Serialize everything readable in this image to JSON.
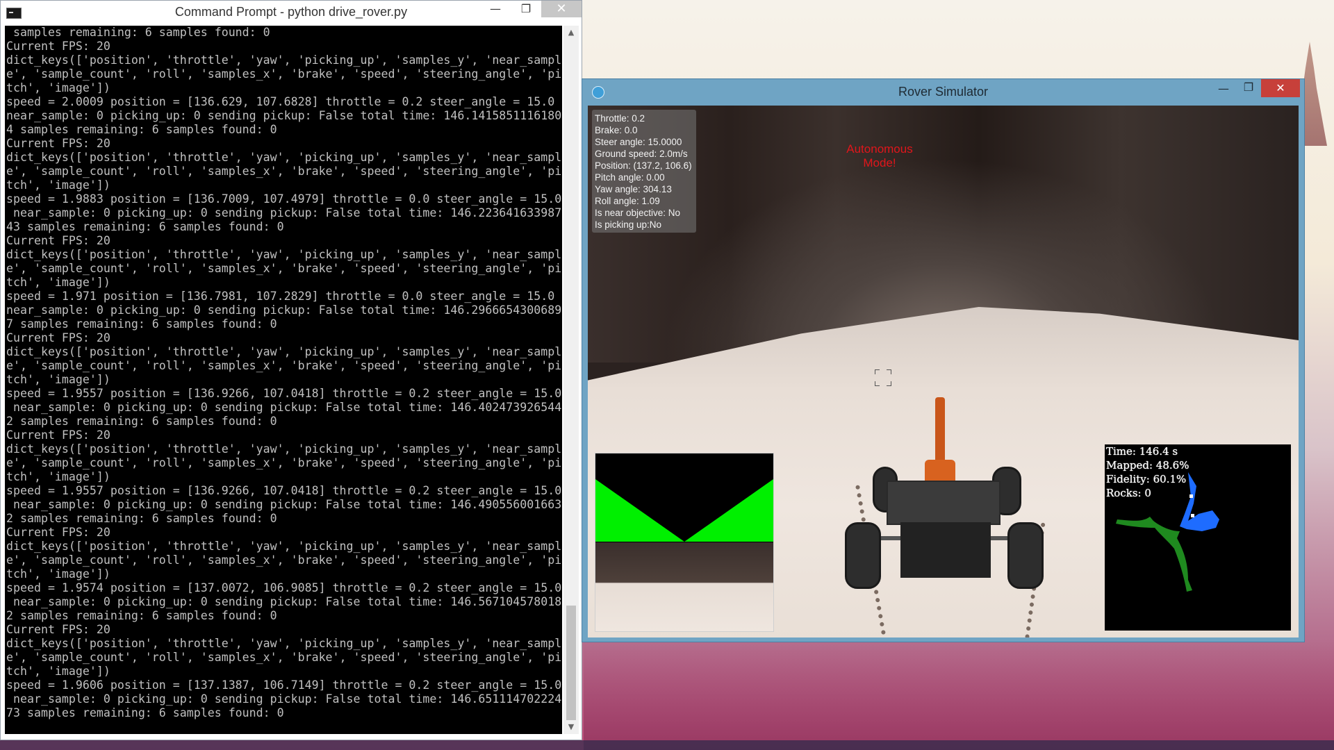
{
  "cmd": {
    "title": "Command Prompt - python  drive_rover.py",
    "minimize": "—",
    "maximize": "❐",
    "close": "✕",
    "lines": [
      " samples remaining: 6 samples found: 0",
      "Current FPS: 20",
      "dict_keys(['position', 'throttle', 'yaw', 'picking_up', 'samples_y', 'near_sampl",
      "e', 'sample_count', 'roll', 'samples_x', 'brake', 'speed', 'steering_angle', 'pi",
      "tch', 'image'])",
      "speed = 2.0009 position = [136.629, 107.6828] throttle = 0.2 steer_angle = 15.0",
      "near_sample: 0 picking_up: 0 sending pickup: False total time: 146.1415851116180",
      "4 samples remaining: 6 samples found: 0",
      "Current FPS: 20",
      "dict_keys(['position', 'throttle', 'yaw', 'picking_up', 'samples_y', 'near_sampl",
      "e', 'sample_count', 'roll', 'samples_x', 'brake', 'speed', 'steering_angle', 'pi",
      "tch', 'image'])",
      "speed = 1.9883 position = [136.7009, 107.4979] throttle = 0.0 steer_angle = 15.0",
      " near_sample: 0 picking_up: 0 sending pickup: False total time: 146.223641633987",
      "43 samples remaining: 6 samples found: 0",
      "Current FPS: 20",
      "dict_keys(['position', 'throttle', 'yaw', 'picking_up', 'samples_y', 'near_sampl",
      "e', 'sample_count', 'roll', 'samples_x', 'brake', 'speed', 'steering_angle', 'pi",
      "tch', 'image'])",
      "speed = 1.971 position = [136.7981, 107.2829] throttle = 0.0 steer_angle = 15.0",
      "near_sample: 0 picking_up: 0 sending pickup: False total time: 146.2966654300689",
      "7 samples remaining: 6 samples found: 0",
      "Current FPS: 20",
      "dict_keys(['position', 'throttle', 'yaw', 'picking_up', 'samples_y', 'near_sampl",
      "e', 'sample_count', 'roll', 'samples_x', 'brake', 'speed', 'steering_angle', 'pi",
      "tch', 'image'])",
      "speed = 1.9557 position = [136.9266, 107.0418] throttle = 0.2 steer_angle = 15.0",
      " near_sample: 0 picking_up: 0 sending pickup: False total time: 146.402473926544",
      "2 samples remaining: 6 samples found: 0",
      "Current FPS: 20",
      "dict_keys(['position', 'throttle', 'yaw', 'picking_up', 'samples_y', 'near_sampl",
      "e', 'sample_count', 'roll', 'samples_x', 'brake', 'speed', 'steering_angle', 'pi",
      "tch', 'image'])",
      "speed = 1.9557 position = [136.9266, 107.0418] throttle = 0.2 steer_angle = 15.0",
      " near_sample: 0 picking_up: 0 sending pickup: False total time: 146.490556001663",
      "2 samples remaining: 6 samples found: 0",
      "Current FPS: 20",
      "dict_keys(['position', 'throttle', 'yaw', 'picking_up', 'samples_y', 'near_sampl",
      "e', 'sample_count', 'roll', 'samples_x', 'brake', 'speed', 'steering_angle', 'pi",
      "tch', 'image'])",
      "speed = 1.9574 position = [137.0072, 106.9085] throttle = 0.2 steer_angle = 15.0",
      " near_sample: 0 picking_up: 0 sending pickup: False total time: 146.567104578018",
      "2 samples remaining: 6 samples found: 0",
      "Current FPS: 20",
      "dict_keys(['position', 'throttle', 'yaw', 'picking_up', 'samples_y', 'near_sampl",
      "e', 'sample_count', 'roll', 'samples_x', 'brake', 'speed', 'steering_angle', 'pi",
      "tch', 'image'])",
      "speed = 1.9606 position = [137.1387, 106.7149] throttle = 0.2 steer_angle = 15.0",
      " near_sample: 0 picking_up: 0 sending pickup: False total time: 146.651114702224",
      "73 samples remaining: 6 samples found: 0"
    ]
  },
  "sim": {
    "title": "Rover Simulator",
    "minimize": "—",
    "maximize": "❐",
    "close": "✕",
    "mode": "Autonomous Mode!",
    "mode_color": "#e0161b",
    "telemetry": [
      "Throttle: 0.2",
      "Brake: 0.0",
      "Steer angle: 15.0000",
      "Ground speed: 2.0m/s",
      "Position: (137.2, 106.6)",
      "Pitch angle: 0.00",
      "Yaw angle: 304.13",
      "Roll angle: 1.09",
      "Is near objective: No",
      "Is picking up:No"
    ],
    "map_stats": {
      "time": "Time: 146.4 s",
      "mapped": "Mapped: 48.6%",
      "fidelity": "Fidelity: 60.1%",
      "rocks": "Rocks: 0"
    },
    "colors": {
      "navigable": "#00f000",
      "mapped_blue": "#1e6cff",
      "map_green": "#1f8a1f"
    }
  }
}
